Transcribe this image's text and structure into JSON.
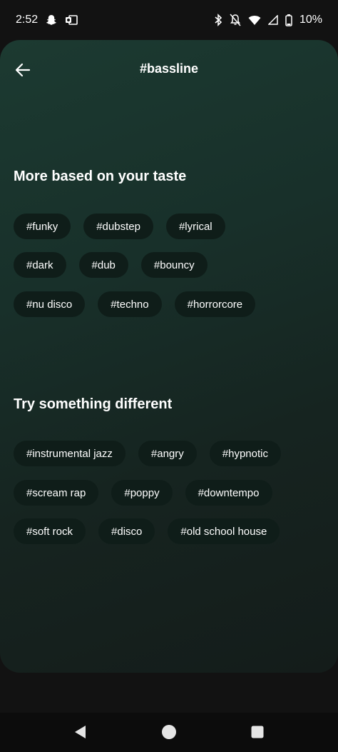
{
  "status_bar": {
    "time": "2:52",
    "battery": "10%",
    "left_icons": [
      "snapchat-icon",
      "outlook-icon"
    ],
    "right_icons": [
      "bluetooth-icon",
      "bell-off-icon",
      "wifi-icon",
      "signal-icon",
      "battery-icon"
    ]
  },
  "header": {
    "title": "#bassline"
  },
  "sections": [
    {
      "title": "More based on your taste",
      "rows": [
        [
          "#funky",
          "#dubstep",
          "#lyrical"
        ],
        [
          "#dark",
          "#dub",
          "#bouncy"
        ],
        [
          "#nu disco",
          "#techno",
          "#horrorcore"
        ]
      ]
    },
    {
      "title": "Try something different",
      "rows": [
        [
          "#instrumental jazz",
          "#angry",
          "#hypnotic"
        ],
        [
          "#scream rap",
          "#poppy",
          "#downtempo"
        ],
        [
          "#soft rock",
          "#disco",
          "#old school house"
        ]
      ]
    }
  ],
  "nav_bar": {
    "icons": [
      "back-triangle-icon",
      "home-circle-icon",
      "recents-square-icon"
    ]
  }
}
